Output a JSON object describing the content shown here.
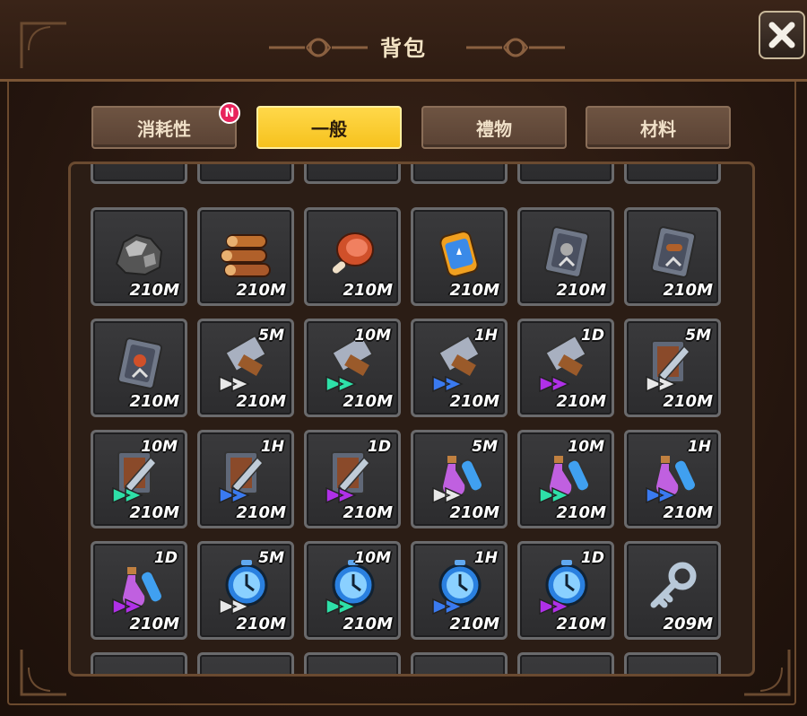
{
  "window": {
    "title": "背包",
    "close_icon": "close-icon"
  },
  "tabs": [
    {
      "label": "消耗性",
      "active": false,
      "badge": "N"
    },
    {
      "label": "一般",
      "active": true
    },
    {
      "label": "禮物",
      "active": false
    },
    {
      "label": "材料",
      "active": false
    }
  ],
  "items": [
    {
      "icon": "ore-icon",
      "qty": "210M"
    },
    {
      "icon": "wood-logs-icon",
      "qty": "210M"
    },
    {
      "icon": "meat-icon",
      "qty": "210M"
    },
    {
      "icon": "scroll-canister-icon",
      "qty": "210M"
    },
    {
      "icon": "ore-ticket-icon",
      "qty": "210M"
    },
    {
      "icon": "wood-ticket-icon",
      "qty": "210M"
    },
    {
      "icon": "meat-ticket-icon",
      "qty": "210M"
    },
    {
      "icon": "construction-speedup-icon",
      "qty": "210M",
      "duration": "5M",
      "tier": "white"
    },
    {
      "icon": "construction-speedup-icon",
      "qty": "210M",
      "duration": "10M",
      "tier": "green"
    },
    {
      "icon": "construction-speedup-icon",
      "qty": "210M",
      "duration": "1H",
      "tier": "blue"
    },
    {
      "icon": "construction-speedup-icon",
      "qty": "210M",
      "duration": "1D",
      "tier": "purple"
    },
    {
      "icon": "training-speedup-icon",
      "qty": "210M",
      "duration": "5M",
      "tier": "white"
    },
    {
      "icon": "training-speedup-icon",
      "qty": "210M",
      "duration": "10M",
      "tier": "green"
    },
    {
      "icon": "training-speedup-icon",
      "qty": "210M",
      "duration": "1H",
      "tier": "blue"
    },
    {
      "icon": "training-speedup-icon",
      "qty": "210M",
      "duration": "1D",
      "tier": "purple"
    },
    {
      "icon": "potion-speedup-icon",
      "qty": "210M",
      "duration": "5M",
      "tier": "white"
    },
    {
      "icon": "potion-speedup-icon",
      "qty": "210M",
      "duration": "10M",
      "tier": "green"
    },
    {
      "icon": "potion-speedup-icon",
      "qty": "210M",
      "duration": "1H",
      "tier": "blue"
    },
    {
      "icon": "potion-speedup-icon",
      "qty": "210M",
      "duration": "1D",
      "tier": "purple"
    },
    {
      "icon": "stopwatch-speedup-icon",
      "qty": "210M",
      "duration": "5M",
      "tier": "white"
    },
    {
      "icon": "stopwatch-speedup-icon",
      "qty": "210M",
      "duration": "10M",
      "tier": "green"
    },
    {
      "icon": "stopwatch-speedup-icon",
      "qty": "210M",
      "duration": "1H",
      "tier": "blue"
    },
    {
      "icon": "stopwatch-speedup-icon",
      "qty": "210M",
      "duration": "1D",
      "tier": "purple"
    },
    {
      "icon": "key-icon",
      "qty": "209M"
    }
  ],
  "colors": {
    "tab_active": "#f6c21e",
    "tab_inactive": "#5a4234",
    "badge": "#e8245c",
    "tier_white": "#e8e8e8",
    "tier_green": "#2ee0a8",
    "tier_blue": "#3a7af0",
    "tier_purple": "#b030e8"
  }
}
